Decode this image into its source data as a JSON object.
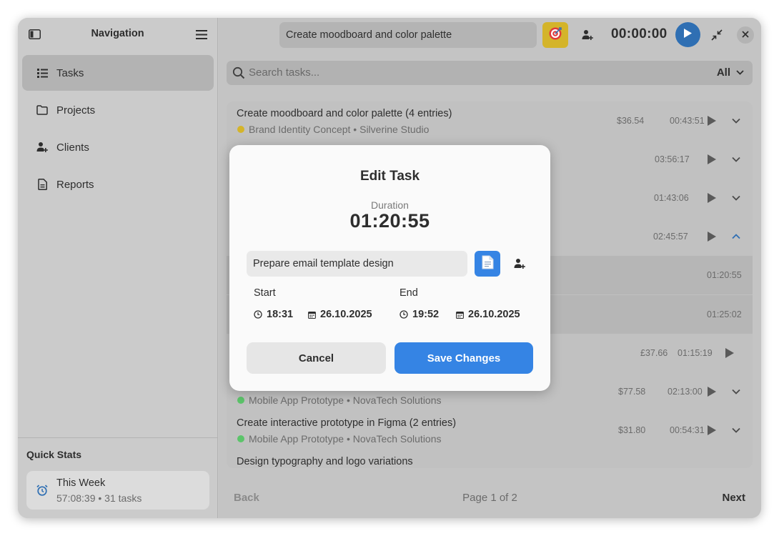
{
  "sidebar": {
    "title": "Navigation",
    "items": [
      {
        "label": "Tasks",
        "icon": "list-icon",
        "active": true
      },
      {
        "label": "Projects",
        "icon": "folder-icon"
      },
      {
        "label": "Clients",
        "icon": "client-icon"
      },
      {
        "label": "Reports",
        "icon": "report-icon"
      }
    ],
    "quick_stats": {
      "title": "Quick Stats",
      "card_label": "This Week",
      "card_sub": "57:08:39 • 31 tasks"
    }
  },
  "header": {
    "current_task": "Create moodboard and color palette",
    "timer": "00:00:00"
  },
  "search": {
    "placeholder": "Search tasks...",
    "filter": "All"
  },
  "tasks": [
    {
      "title": "Create moodboard and color palette (4 entries)",
      "meta": "Brand Identity Concept • Silverine Studio",
      "dot_color": "#d4b42a",
      "amount": "$36.54",
      "duration": "00:43:51",
      "chevron": "down"
    },
    {
      "title": "",
      "meta": "",
      "amount": "",
      "duration": "03:56:17",
      "chevron": "down"
    },
    {
      "title": "",
      "meta": "",
      "amount": "",
      "duration": "01:43:06",
      "chevron": "down"
    },
    {
      "title": "",
      "meta": "",
      "amount": "",
      "duration": "02:45:57",
      "chevron": "up"
    },
    {
      "title": "",
      "meta": "",
      "amount": "",
      "duration": "01:20:55",
      "sub": true
    },
    {
      "title": "",
      "meta": "",
      "amount": "",
      "duration": "01:25:02",
      "sub": true
    },
    {
      "title": "",
      "meta": "",
      "amount": "£37.66",
      "duration": "01:15:19",
      "play_only": true
    },
    {
      "title": "",
      "meta": "Mobile App Prototype • NovaTech Solutions",
      "dot_color": "#5cc46a",
      "amount": "$77.58",
      "duration": "02:13:00",
      "chevron": "down"
    },
    {
      "title": "Create interactive prototype in Figma (2 entries)",
      "meta": "Mobile App Prototype • NovaTech Solutions",
      "dot_color": "#5cc46a",
      "amount": "$31.80",
      "duration": "00:54:31",
      "chevron": "down"
    },
    {
      "title": "Design typography and logo variations",
      "meta": "",
      "amount": "",
      "duration": "",
      "chevron": ""
    }
  ],
  "pagination": {
    "back": "Back",
    "page": "Page 1 of 2",
    "next": "Next"
  },
  "dialog": {
    "title": "Edit Task",
    "duration_label": "Duration",
    "duration": "01:20:55",
    "task_name": "Prepare email template design",
    "start_label": "Start",
    "start_time": "18:31",
    "start_date": "26.10.2025",
    "end_label": "End",
    "end_time": "19:52",
    "end_date": "26.10.2025",
    "cancel": "Cancel",
    "save": "Save Changes"
  },
  "colors": {
    "accent": "#3584e4",
    "target_button": "#d4b42a",
    "dot_yellow": "#d4b42a",
    "dot_green": "#5cc46a"
  }
}
